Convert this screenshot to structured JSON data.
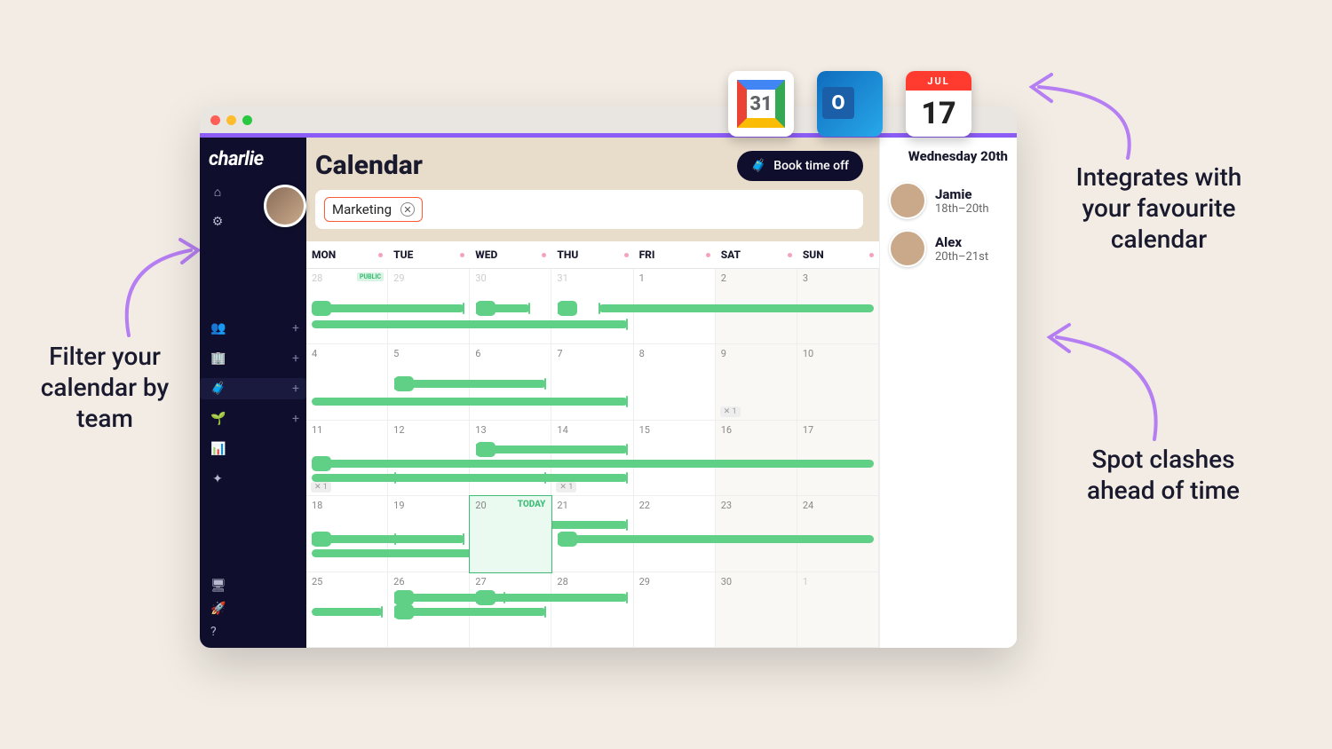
{
  "annotations": {
    "left": "Filter your\ncalendar by\nteam",
    "right_top": "Integrates with\nyour favourite\ncalendar",
    "right_bottom": "Spot clashes\nahead of time"
  },
  "integrations": {
    "apple_cal_month": "JUL",
    "apple_cal_day": "17",
    "google_cal_day": "31"
  },
  "app_name": "charlie",
  "page_title": "Calendar",
  "book_button": "Book time off",
  "filter_chip": "Marketing",
  "weekdays": [
    "MON",
    "TUE",
    "WED",
    "THU",
    "FRI",
    "SAT",
    "SUN"
  ],
  "today_label": "TODAY",
  "public_label": "PUBLIC",
  "cells": [
    [
      {
        "d": "28",
        "muted": true,
        "public": true
      },
      {
        "d": "29",
        "muted": true
      },
      {
        "d": "30",
        "muted": true
      },
      {
        "d": "31",
        "muted": true
      },
      {
        "d": "1"
      },
      {
        "d": "2",
        "weekend": true
      },
      {
        "d": "3",
        "weekend": true
      }
    ],
    [
      {
        "d": "4"
      },
      {
        "d": "5"
      },
      {
        "d": "6"
      },
      {
        "d": "7"
      },
      {
        "d": "8"
      },
      {
        "d": "9",
        "weekend": true,
        "count": "1"
      },
      {
        "d": "10",
        "weekend": true
      }
    ],
    [
      {
        "d": "11",
        "count": "1"
      },
      {
        "d": "12"
      },
      {
        "d": "13"
      },
      {
        "d": "14",
        "count": "1"
      },
      {
        "d": "15"
      },
      {
        "d": "16",
        "weekend": true
      },
      {
        "d": "17",
        "weekend": true
      }
    ],
    [
      {
        "d": "18"
      },
      {
        "d": "19"
      },
      {
        "d": "20",
        "today": true
      },
      {
        "d": "21"
      },
      {
        "d": "22"
      },
      {
        "d": "23",
        "weekend": true
      },
      {
        "d": "24",
        "weekend": true
      }
    ],
    [
      {
        "d": "25"
      },
      {
        "d": "26"
      },
      {
        "d": "27"
      },
      {
        "d": "28"
      },
      {
        "d": "29"
      },
      {
        "d": "30",
        "weekend": true
      },
      {
        "d": "1",
        "weekend": true,
        "muted": true
      }
    ]
  ],
  "right_panel": {
    "title": "Wednesday 20th",
    "people": [
      {
        "name": "Jamie",
        "sub": "18th–20th"
      },
      {
        "name": "Alex",
        "sub": "20th–21st"
      }
    ]
  },
  "nav_icons": [
    "⌂",
    "⚙"
  ],
  "nav_mid": [
    {
      "icon": "👥",
      "plus": true
    },
    {
      "icon": "🏢",
      "plus": true
    },
    {
      "icon": "🧳",
      "plus": true,
      "active": true
    },
    {
      "icon": "🌱",
      "plus": true
    },
    {
      "icon": "📊"
    },
    {
      "icon": "✦"
    }
  ],
  "nav_bottom": [
    "🖥",
    "🚀",
    "?"
  ]
}
